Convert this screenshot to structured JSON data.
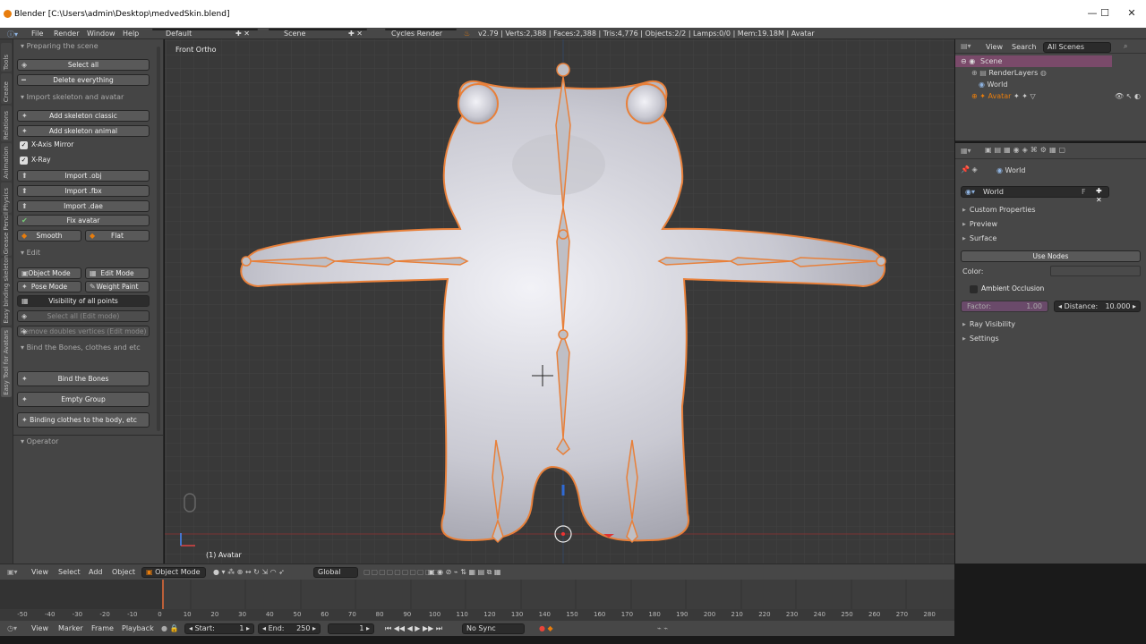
{
  "app": {
    "title": "Blender [C:\\Users\\admin\\Desktop\\medvedSkin.blend]",
    "controls": {
      "minimize": "—",
      "maximize": "☐",
      "close": "✕"
    }
  },
  "infobar": {
    "menu": [
      "File",
      "Render",
      "Window",
      "Help"
    ],
    "layout": "Default",
    "scene": "Scene",
    "engine": "Cycles Render",
    "stats": "v2.79 | Verts:2,388 | Faces:2,388 | Tris:4,776 | Objects:2/2 | Lamps:0/0 | Mem:19.18M | Avatar"
  },
  "tabs": [
    "Tools",
    "Create",
    "Relations",
    "Animation",
    "Physics",
    "Grease Pencil",
    "Easy binding skeleton",
    "Easy Tool for Avatars"
  ],
  "toolshelf": {
    "sec_prepare": "Preparing the scene",
    "select_all": "Select all",
    "delete_everything": "Delete everything",
    "sec_import": "Import skeleton and avatar",
    "add_skel_classic": "Add skeleton classic",
    "add_skel_animal": "Add skeleton animal",
    "xaxis_mirror": "X-Axis Mirror",
    "xray": "X-Ray",
    "import_obj": "Import .obj",
    "import_fbx": "Import .fbx",
    "import_dae": "Import .dae",
    "fix_avatar": "Fix avatar",
    "smooth": "Smooth",
    "flat": "Flat",
    "sec_edit": "Edit",
    "object_mode": "Object Mode",
    "edit_mode": "Edit Mode",
    "pose_mode": "Pose Mode",
    "weight_paint": "Weight Paint",
    "visibility": "Visibility of all points",
    "select_all_edit": "Select all (Edit mode)",
    "remove_doubles": "Remove doubles vertices (Edit mode)",
    "sec_bind": "Bind the Bones, clothes and etc",
    "bind_bones": "Bind the Bones",
    "empty_group": "Empty Group",
    "binding_clothes": "Binding clothes to the body, etc",
    "sec_operator": "Operator"
  },
  "viewport": {
    "view_name": "Front Ortho",
    "object_label": "(1) Avatar"
  },
  "outliner": {
    "view": "View",
    "search": "Search",
    "scenes": "All Scenes",
    "items": [
      "Scene",
      "RenderLayers",
      "World",
      "Avatar"
    ]
  },
  "properties": {
    "context": "World",
    "world_name": "World",
    "f_badge": "F",
    "custom_props": "Custom Properties",
    "preview": "Preview",
    "surface": "Surface",
    "use_nodes": "Use Nodes",
    "color_label": "Color:",
    "ambient_occlusion": "Ambient Occlusion",
    "factor_label": "Factor:",
    "factor_value": "1.00",
    "distance_label": "Distance:",
    "distance_value": "10.000",
    "ray_visibility": "Ray Visibility",
    "settings": "Settings"
  },
  "header3d": {
    "menu": [
      "View",
      "Select",
      "Add",
      "Object"
    ],
    "mode": "Object Mode",
    "orientation": "Global"
  },
  "timeline": {
    "ticks": [
      "-50",
      "-40",
      "-30",
      "-20",
      "-10",
      "0",
      "10",
      "20",
      "30",
      "40",
      "50",
      "60",
      "70",
      "80",
      "90",
      "100",
      "110",
      "120",
      "130",
      "140",
      "150",
      "160",
      "170",
      "180",
      "190",
      "200",
      "210",
      "220",
      "230",
      "240",
      "250",
      "260",
      "270",
      "280"
    ],
    "current_frame": "0"
  },
  "timebar": {
    "menu": [
      "View",
      "Marker",
      "Frame",
      "Playback"
    ],
    "start_label": "Start:",
    "start_value": "1",
    "end_label": "End:",
    "end_value": "250",
    "current": "1",
    "sync": "No Sync"
  },
  "colors": {
    "accent": "#e87d0d",
    "selection": "#7a4a6a",
    "bone_outline": "#ff8c3a"
  }
}
